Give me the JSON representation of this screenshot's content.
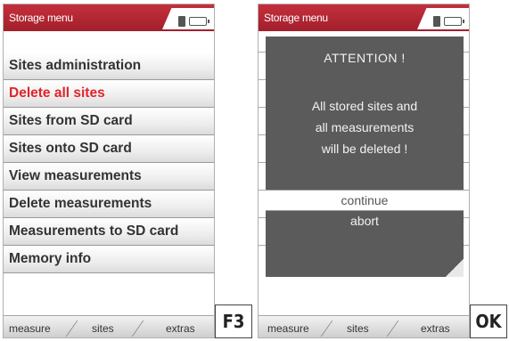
{
  "left_screen": {
    "title": "Storage menu",
    "menu_items": [
      {
        "label": "Sites administration"
      },
      {
        "label": "Delete all sites"
      },
      {
        "label": "Sites from SD card"
      },
      {
        "label": "Sites onto SD card"
      },
      {
        "label": "View measurements"
      },
      {
        "label": "Delete measurements"
      },
      {
        "label": "Measurements to SD card"
      },
      {
        "label": "Memory info"
      }
    ],
    "active_item": "Delete all sites",
    "softkeys": {
      "measure": "measure",
      "sites": "sites",
      "extras": "extras"
    }
  },
  "right_screen": {
    "title": "Storage menu",
    "dialog": {
      "title": "ATTENTION !",
      "message_lines": [
        "All stored sites and",
        "all measurements",
        "will be deleted !"
      ],
      "options": [
        {
          "label": "continue",
          "selected": true
        },
        {
          "label": "abort",
          "selected": false
        }
      ]
    },
    "softkeys": {
      "measure": "measure",
      "sites": "sites",
      "extras": "extras"
    }
  },
  "function_keys": {
    "left": "F3",
    "right": "OK"
  },
  "colors": {
    "title_bar": "#b52633",
    "active_text": "#e0242c",
    "dialog_bg": "#5b5b5b"
  },
  "icons": [
    "plug-icon",
    "battery-icon"
  ]
}
